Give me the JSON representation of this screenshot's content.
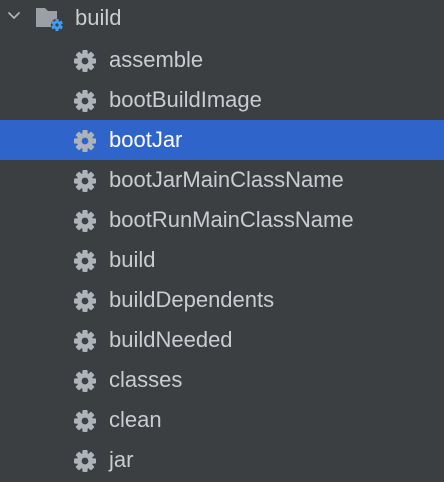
{
  "tree": {
    "root": {
      "label": "build",
      "expanded": true,
      "icon": "folder-gear-icon"
    },
    "tasks": [
      {
        "label": "assemble",
        "selected": false
      },
      {
        "label": "bootBuildImage",
        "selected": false
      },
      {
        "label": "bootJar",
        "selected": true
      },
      {
        "label": "bootJarMainClassName",
        "selected": false
      },
      {
        "label": "bootRunMainClassName",
        "selected": false
      },
      {
        "label": "build",
        "selected": false
      },
      {
        "label": "buildDependents",
        "selected": false
      },
      {
        "label": "buildNeeded",
        "selected": false
      },
      {
        "label": "classes",
        "selected": false
      },
      {
        "label": "clean",
        "selected": false
      },
      {
        "label": "jar",
        "selected": false
      }
    ],
    "task_icon": "gear-icon"
  },
  "colors": {
    "background": "#3c3f41",
    "selection": "#2f65ca",
    "text": "#c9ccd0",
    "selected_text": "#ffffff",
    "icon": "#aeb3b9",
    "folder_gear": "#3d9ef5"
  }
}
